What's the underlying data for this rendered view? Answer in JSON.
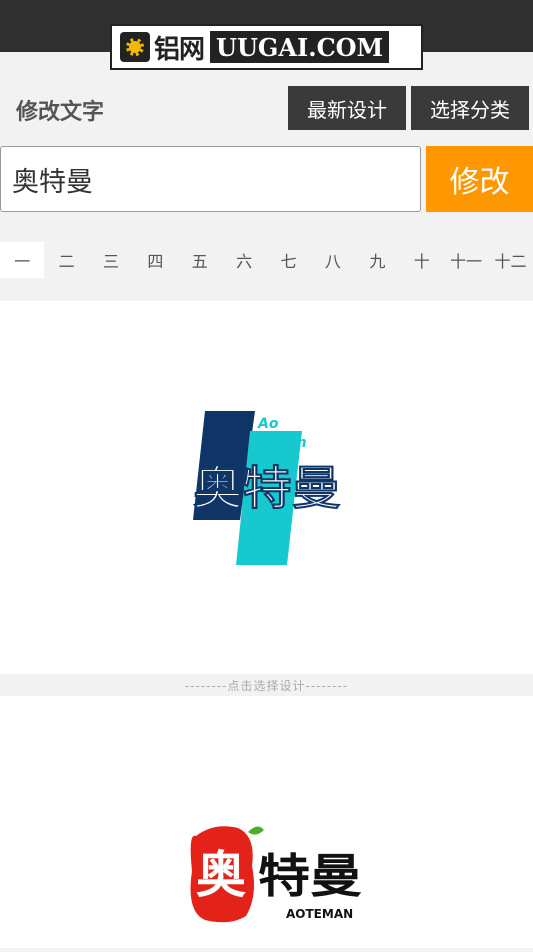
{
  "header": {
    "logo_cn": "铝网",
    "logo_en": "UUGAI.COM"
  },
  "toolbar": {
    "edit_label": "修改文字",
    "latest_design_label": "最新设计",
    "choose_category_label": "选择分类"
  },
  "editor": {
    "input_value": "奥特曼",
    "modify_label": "修改"
  },
  "tabs": [
    "一",
    "二",
    "三",
    "四",
    "五",
    "六",
    "七",
    "八",
    "九",
    "十",
    "十一",
    "十二"
  ],
  "active_tab_index": 0,
  "designs": [
    {
      "main_text": "奥特曼",
      "sub_line1": "Ao",
      "sub_line2": "TeMan",
      "colors": {
        "navy": "#0f3566",
        "teal": "#15c9cf"
      }
    },
    {
      "seal_char": "奥",
      "main_text": "特曼",
      "sub_text": "AOTEMAN",
      "colors": {
        "red": "#e32219",
        "leaf": "#4caf2c",
        "ink": "#111111"
      }
    }
  ],
  "select_hint": "--------点击选择设计--------"
}
